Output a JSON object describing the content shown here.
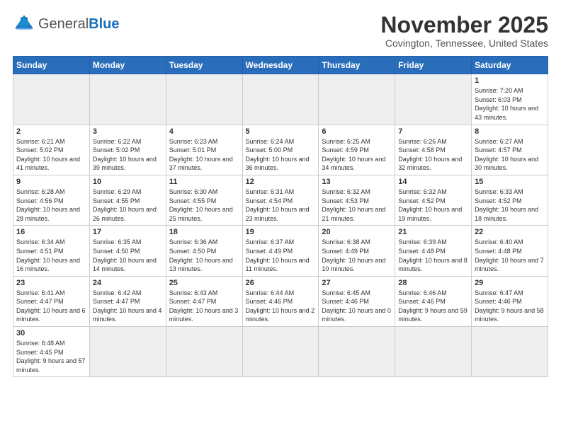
{
  "logo": {
    "text_general": "General",
    "text_blue": "Blue"
  },
  "header": {
    "month": "November 2025",
    "location": "Covington, Tennessee, United States"
  },
  "weekdays": [
    "Sunday",
    "Monday",
    "Tuesday",
    "Wednesday",
    "Thursday",
    "Friday",
    "Saturday"
  ],
  "weeks": [
    [
      {
        "day": "",
        "empty": true
      },
      {
        "day": "",
        "empty": true
      },
      {
        "day": "",
        "empty": true
      },
      {
        "day": "",
        "empty": true
      },
      {
        "day": "",
        "empty": true
      },
      {
        "day": "",
        "empty": true
      },
      {
        "day": "1",
        "sunrise": "Sunrise: 7:20 AM",
        "sunset": "Sunset: 6:03 PM",
        "daylight": "Daylight: 10 hours and 43 minutes."
      }
    ],
    [
      {
        "day": "2",
        "sunrise": "Sunrise: 6:21 AM",
        "sunset": "Sunset: 5:02 PM",
        "daylight": "Daylight: 10 hours and 41 minutes."
      },
      {
        "day": "3",
        "sunrise": "Sunrise: 6:22 AM",
        "sunset": "Sunset: 5:02 PM",
        "daylight": "Daylight: 10 hours and 39 minutes."
      },
      {
        "day": "4",
        "sunrise": "Sunrise: 6:23 AM",
        "sunset": "Sunset: 5:01 PM",
        "daylight": "Daylight: 10 hours and 37 minutes."
      },
      {
        "day": "5",
        "sunrise": "Sunrise: 6:24 AM",
        "sunset": "Sunset: 5:00 PM",
        "daylight": "Daylight: 10 hours and 36 minutes."
      },
      {
        "day": "6",
        "sunrise": "Sunrise: 6:25 AM",
        "sunset": "Sunset: 4:59 PM",
        "daylight": "Daylight: 10 hours and 34 minutes."
      },
      {
        "day": "7",
        "sunrise": "Sunrise: 6:26 AM",
        "sunset": "Sunset: 4:58 PM",
        "daylight": "Daylight: 10 hours and 32 minutes."
      },
      {
        "day": "8",
        "sunrise": "Sunrise: 6:27 AM",
        "sunset": "Sunset: 4:57 PM",
        "daylight": "Daylight: 10 hours and 30 minutes."
      }
    ],
    [
      {
        "day": "9",
        "sunrise": "Sunrise: 6:28 AM",
        "sunset": "Sunset: 4:56 PM",
        "daylight": "Daylight: 10 hours and 28 minutes."
      },
      {
        "day": "10",
        "sunrise": "Sunrise: 6:29 AM",
        "sunset": "Sunset: 4:55 PM",
        "daylight": "Daylight: 10 hours and 26 minutes."
      },
      {
        "day": "11",
        "sunrise": "Sunrise: 6:30 AM",
        "sunset": "Sunset: 4:55 PM",
        "daylight": "Daylight: 10 hours and 25 minutes."
      },
      {
        "day": "12",
        "sunrise": "Sunrise: 6:31 AM",
        "sunset": "Sunset: 4:54 PM",
        "daylight": "Daylight: 10 hours and 23 minutes."
      },
      {
        "day": "13",
        "sunrise": "Sunrise: 6:32 AM",
        "sunset": "Sunset: 4:53 PM",
        "daylight": "Daylight: 10 hours and 21 minutes."
      },
      {
        "day": "14",
        "sunrise": "Sunrise: 6:32 AM",
        "sunset": "Sunset: 4:52 PM",
        "daylight": "Daylight: 10 hours and 19 minutes."
      },
      {
        "day": "15",
        "sunrise": "Sunrise: 6:33 AM",
        "sunset": "Sunset: 4:52 PM",
        "daylight": "Daylight: 10 hours and 18 minutes."
      }
    ],
    [
      {
        "day": "16",
        "sunrise": "Sunrise: 6:34 AM",
        "sunset": "Sunset: 4:51 PM",
        "daylight": "Daylight: 10 hours and 16 minutes."
      },
      {
        "day": "17",
        "sunrise": "Sunrise: 6:35 AM",
        "sunset": "Sunset: 4:50 PM",
        "daylight": "Daylight: 10 hours and 14 minutes."
      },
      {
        "day": "18",
        "sunrise": "Sunrise: 6:36 AM",
        "sunset": "Sunset: 4:50 PM",
        "daylight": "Daylight: 10 hours and 13 minutes."
      },
      {
        "day": "19",
        "sunrise": "Sunrise: 6:37 AM",
        "sunset": "Sunset: 4:49 PM",
        "daylight": "Daylight: 10 hours and 11 minutes."
      },
      {
        "day": "20",
        "sunrise": "Sunrise: 6:38 AM",
        "sunset": "Sunset: 4:49 PM",
        "daylight": "Daylight: 10 hours and 10 minutes."
      },
      {
        "day": "21",
        "sunrise": "Sunrise: 6:39 AM",
        "sunset": "Sunset: 4:48 PM",
        "daylight": "Daylight: 10 hours and 8 minutes."
      },
      {
        "day": "22",
        "sunrise": "Sunrise: 6:40 AM",
        "sunset": "Sunset: 4:48 PM",
        "daylight": "Daylight: 10 hours and 7 minutes."
      }
    ],
    [
      {
        "day": "23",
        "sunrise": "Sunrise: 6:41 AM",
        "sunset": "Sunset: 4:47 PM",
        "daylight": "Daylight: 10 hours and 6 minutes."
      },
      {
        "day": "24",
        "sunrise": "Sunrise: 6:42 AM",
        "sunset": "Sunset: 4:47 PM",
        "daylight": "Daylight: 10 hours and 4 minutes."
      },
      {
        "day": "25",
        "sunrise": "Sunrise: 6:43 AM",
        "sunset": "Sunset: 4:47 PM",
        "daylight": "Daylight: 10 hours and 3 minutes."
      },
      {
        "day": "26",
        "sunrise": "Sunrise: 6:44 AM",
        "sunset": "Sunset: 4:46 PM",
        "daylight": "Daylight: 10 hours and 2 minutes."
      },
      {
        "day": "27",
        "sunrise": "Sunrise: 6:45 AM",
        "sunset": "Sunset: 4:46 PM",
        "daylight": "Daylight: 10 hours and 0 minutes."
      },
      {
        "day": "28",
        "sunrise": "Sunrise: 6:46 AM",
        "sunset": "Sunset: 4:46 PM",
        "daylight": "Daylight: 9 hours and 59 minutes."
      },
      {
        "day": "29",
        "sunrise": "Sunrise: 6:47 AM",
        "sunset": "Sunset: 4:46 PM",
        "daylight": "Daylight: 9 hours and 58 minutes."
      }
    ],
    [
      {
        "day": "30",
        "sunrise": "Sunrise: 6:48 AM",
        "sunset": "Sunset: 4:45 PM",
        "daylight": "Daylight: 9 hours and 57 minutes."
      },
      {
        "day": "",
        "empty": true
      },
      {
        "day": "",
        "empty": true
      },
      {
        "day": "",
        "empty": true
      },
      {
        "day": "",
        "empty": true
      },
      {
        "day": "",
        "empty": true
      },
      {
        "day": "",
        "empty": true
      }
    ]
  ]
}
